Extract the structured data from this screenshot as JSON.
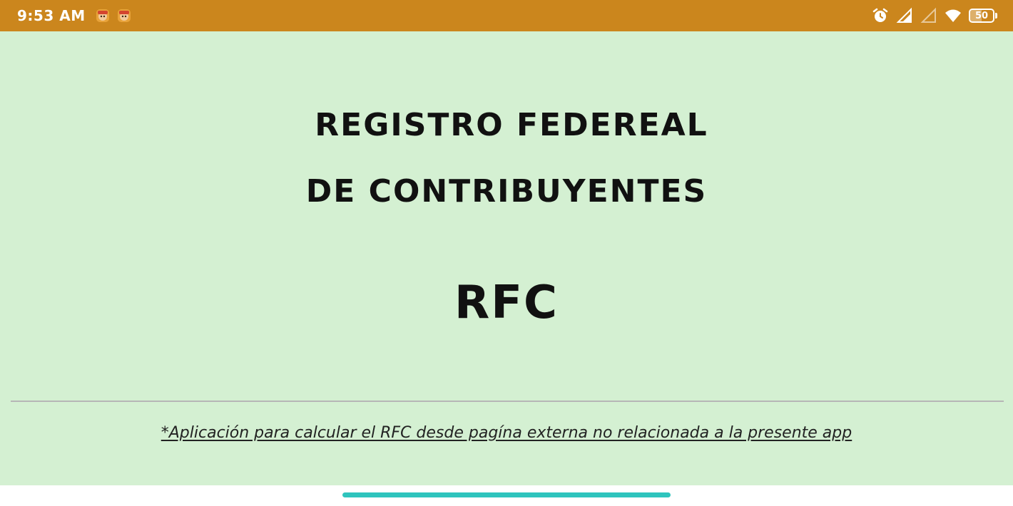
{
  "status_bar": {
    "time": "9:53 AM",
    "background": "#cb861d",
    "notification_icons": [
      "game-notification-icon",
      "game-notification-icon"
    ],
    "right_icons": [
      "alarm-icon",
      "cellular-signal-icon",
      "cellular-signal-empty-icon",
      "wifi-icon",
      "battery-icon"
    ],
    "battery_level": "50",
    "battery_fraction": 0.5
  },
  "main": {
    "background": "#d4f0d2",
    "title_line_1": "REGISTRO FEDEREAL",
    "title_line_2": "DE CONTRIBUYENTES",
    "acronym": "RFC",
    "disclaimer": "*Aplicación para calcular el RFC desde pagína externa no relacionada a la presente app"
  },
  "navigation": {
    "home_indicator_color": "#2fc4bd"
  }
}
